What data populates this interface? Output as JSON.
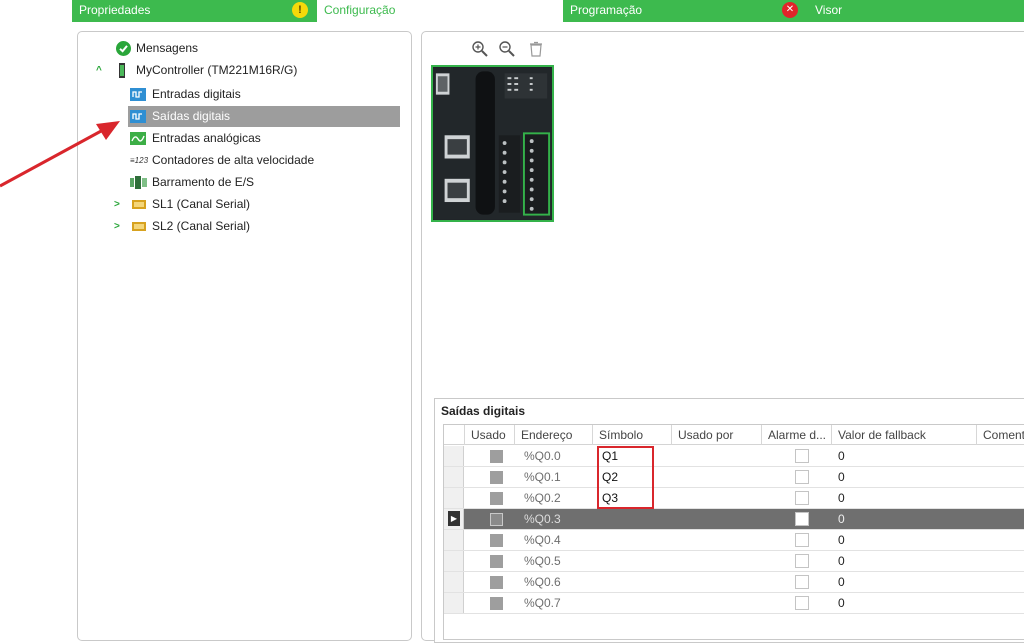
{
  "tabs": [
    {
      "label": "Propriedades",
      "badge": "!"
    },
    {
      "label": "Configuração"
    },
    {
      "label": "Programação",
      "badge": "✕"
    },
    {
      "label": "Visor"
    }
  ],
  "tree": {
    "messages": "Mensagens",
    "controller": "MyController (TM221M16R/G)",
    "items": [
      {
        "label": "Entradas digitais",
        "icon": "digital-input-icon"
      },
      {
        "label": "Saídas digitais",
        "icon": "digital-output-icon",
        "selected": true
      },
      {
        "label": "Entradas analógicas",
        "icon": "analog-input-icon"
      },
      {
        "label": "Contadores de alta velocidade",
        "icon": "high-speed-counter-icon",
        "icon_text": "≡123"
      },
      {
        "label": "Barramento de E/S",
        "icon": "io-bus-icon"
      },
      {
        "label": "SL1 (Canal Serial)",
        "icon": "serial-port-icon"
      },
      {
        "label": "SL2 (Canal Serial)",
        "icon": "serial-port-icon"
      }
    ]
  },
  "toolbar": {
    "icons": [
      "zoom-in-icon",
      "zoom-out-icon",
      "delete-icon"
    ]
  },
  "io_table": {
    "title": "Saídas digitais",
    "columns": [
      "Usado",
      "Endereço",
      "Símbolo",
      "Usado por",
      "Alarme d...",
      "Valor de fallback",
      "Comentário"
    ],
    "rows": [
      {
        "address": "%Q0.0",
        "symbol": "Q1",
        "fallback": "0"
      },
      {
        "address": "%Q0.1",
        "symbol": "Q2",
        "fallback": "0"
      },
      {
        "address": "%Q0.2",
        "symbol": "Q3",
        "fallback": "0"
      },
      {
        "address": "%Q0.3",
        "symbol": "",
        "fallback": "0",
        "current": true
      },
      {
        "address": "%Q0.4",
        "symbol": "",
        "fallback": "0"
      },
      {
        "address": "%Q0.5",
        "symbol": "",
        "fallback": "0"
      },
      {
        "address": "%Q0.6",
        "symbol": "",
        "fallback": "0"
      },
      {
        "address": "%Q0.7",
        "symbol": "",
        "fallback": "0"
      }
    ]
  },
  "colors": {
    "accent": "#3dba4e",
    "selection": "#9d9d9d",
    "annotation": "#d9262c"
  }
}
